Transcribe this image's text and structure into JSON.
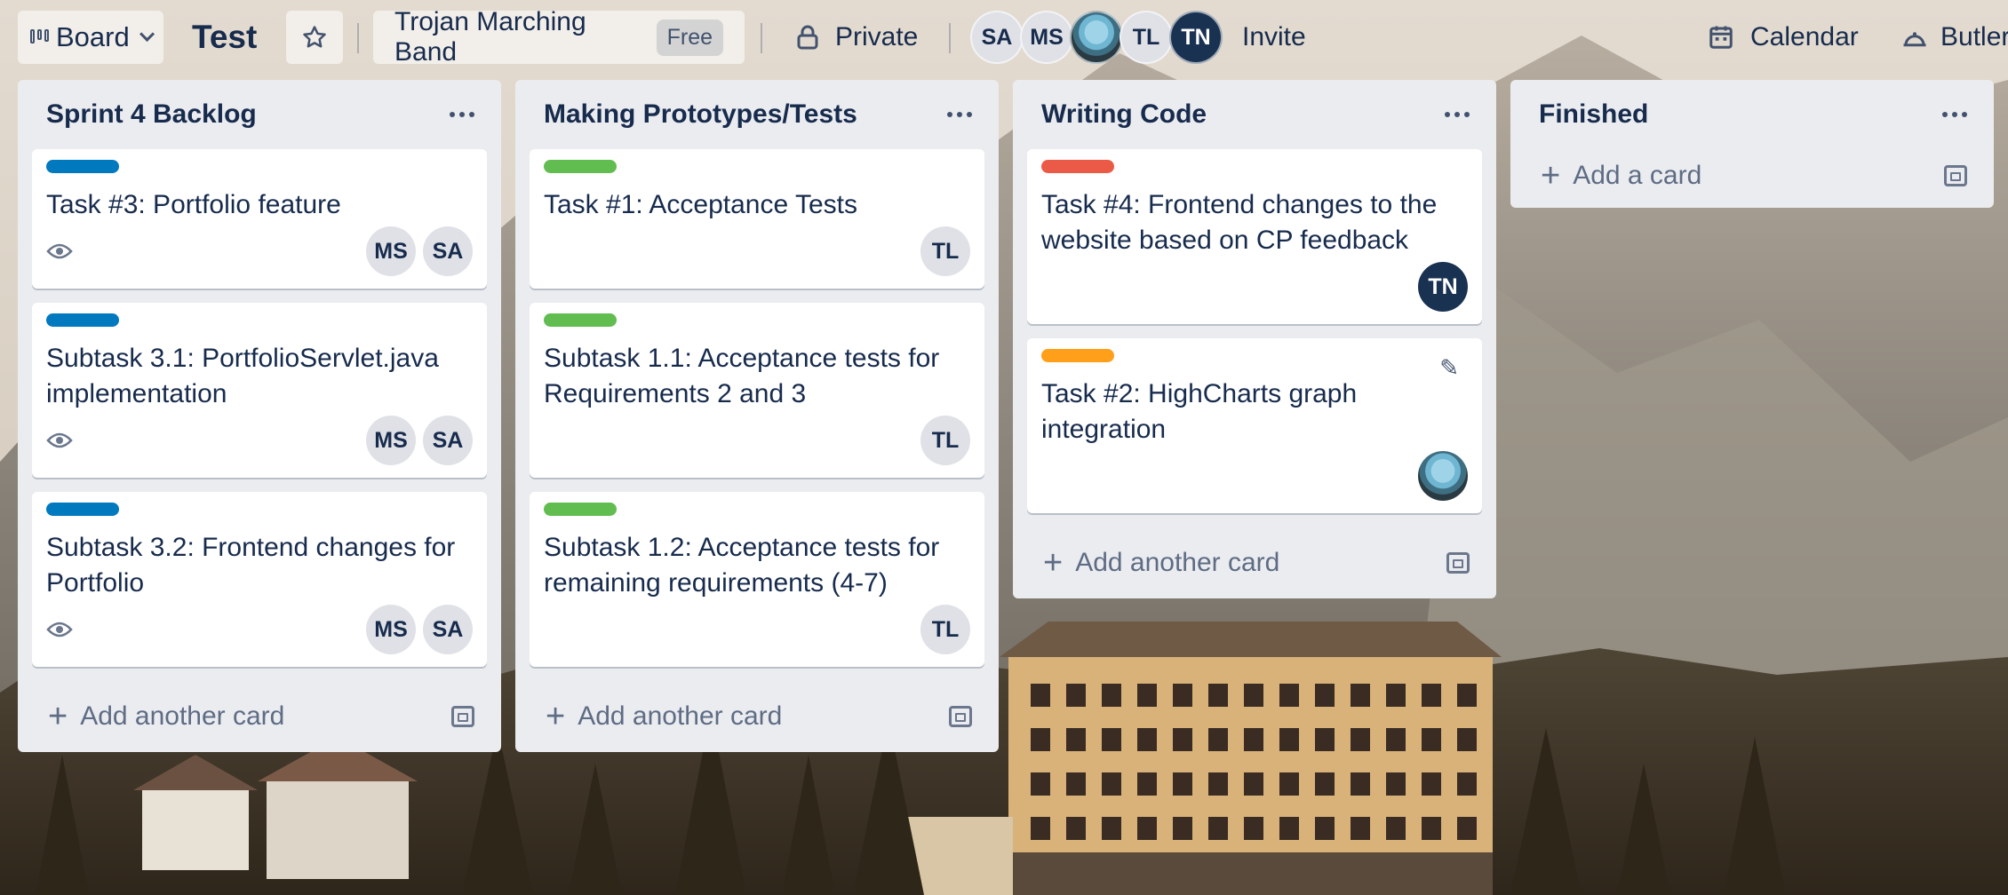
{
  "topbar": {
    "view_label": "Board",
    "board_title": "Test",
    "team_name": "Trojan Marching Band",
    "team_badge": "Free",
    "visibility": "Private",
    "members": [
      {
        "initials": "SA",
        "style": "light"
      },
      {
        "initials": "MS",
        "style": "light"
      },
      {
        "initials": "",
        "style": "avatar-image"
      },
      {
        "initials": "TL",
        "style": "light"
      },
      {
        "initials": "TN",
        "style": "dark"
      }
    ],
    "invite_label": "Invite",
    "calendar_label": "Calendar",
    "butler_label": "Butler"
  },
  "lists": [
    {
      "title": "Sprint 4 Backlog",
      "cards": [
        {
          "label_color": "#0079bf",
          "title": "Task #3: Portfolio feature",
          "watching": true,
          "members": [
            "MS",
            "SA"
          ]
        },
        {
          "label_color": "#0079bf",
          "title": "Subtask 3.1: PortfolioServlet.java implementation",
          "watching": true,
          "members": [
            "MS",
            "SA"
          ]
        },
        {
          "label_color": "#0079bf",
          "title": "Subtask 3.2: Frontend changes for Portfolio",
          "watching": true,
          "members": [
            "MS",
            "SA"
          ]
        }
      ],
      "add_label": "Add another card"
    },
    {
      "title": "Making Prototypes/Tests",
      "cards": [
        {
          "label_color": "#61bd4f",
          "title": "Task #1: Acceptance Tests",
          "watching": false,
          "members": [
            "TL"
          ]
        },
        {
          "label_color": "#61bd4f",
          "title": "Subtask 1.1: Acceptance tests for Requirements 2 and 3",
          "watching": false,
          "members": [
            "TL"
          ]
        },
        {
          "label_color": "#61bd4f",
          "title": "Subtask 1.2: Acceptance tests for remaining requirements (4-7)",
          "watching": false,
          "members": [
            "TL"
          ]
        }
      ],
      "add_label": "Add another card"
    },
    {
      "title": "Writing Code",
      "cards": [
        {
          "label_color": "#eb5a46",
          "title": "Task #4: Frontend changes to the website based on CP feedback",
          "watching": false,
          "members": [
            "TN"
          ]
        },
        {
          "label_color": "#ff9f1a",
          "title": "Task #2: HighCharts graph integration",
          "watching": false,
          "members": [
            "avatar-image"
          ]
        }
      ],
      "add_label": "Add another card"
    },
    {
      "title": "Finished",
      "cards": [],
      "add_label": "Add a card"
    }
  ],
  "icons": {
    "board_view": "board-icon",
    "star": "star-icon",
    "lock": "lock-icon",
    "calendar": "calendar-icon",
    "butler": "butler-icon",
    "menu": "ellipsis-icon",
    "watch": "eye-icon",
    "template": "card-template-icon",
    "edit": "pencil-icon",
    "add": "plus-icon"
  }
}
